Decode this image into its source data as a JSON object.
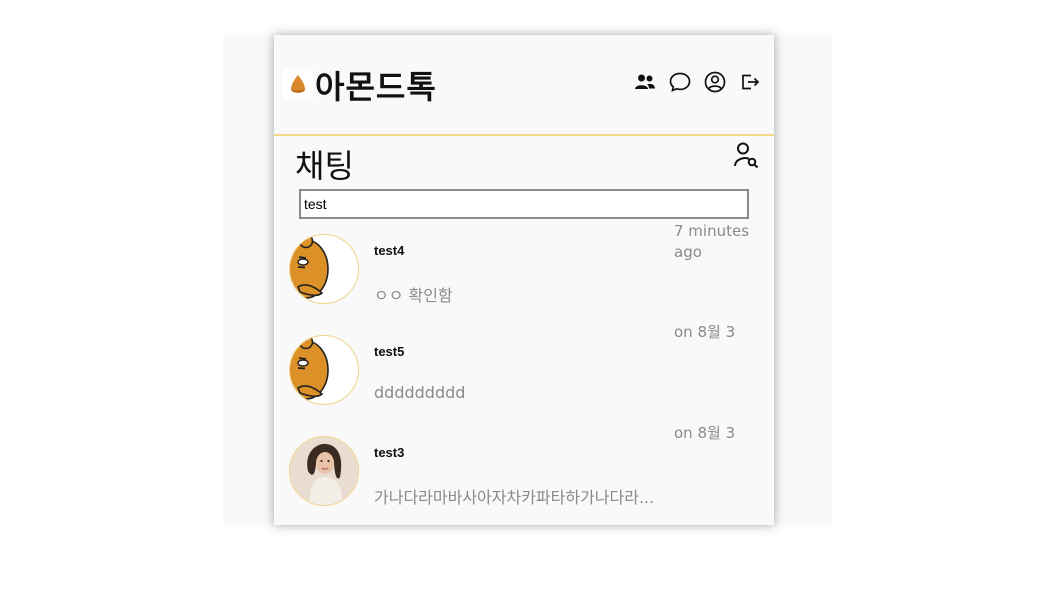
{
  "app": {
    "title": "아몬드톡",
    "logo_icon": "almond-icon"
  },
  "header_icons": [
    "friends-icon",
    "chat-bubble-icon",
    "profile-icon",
    "logout-icon"
  ],
  "page": {
    "title": "채팅",
    "user_search_icon": "user-search-icon"
  },
  "search": {
    "value": "test",
    "placeholder": ""
  },
  "chats": [
    {
      "name": "test4",
      "time": "7 minutes ago",
      "message": "ㅇㅇ 확인함",
      "avatar": "bear-avatar"
    },
    {
      "name": "test5",
      "time": "on 8월 3",
      "message": "ddddddddd",
      "avatar": "bear-avatar"
    },
    {
      "name": "test3",
      "time": "on 8월 3",
      "message": "가나다라마바사아자차카파타하가나다라...",
      "avatar": "person-avatar"
    }
  ],
  "colors": {
    "accent": "#f5d98a",
    "background": "#f9f9f9",
    "muted_text": "#8a8a8a"
  }
}
